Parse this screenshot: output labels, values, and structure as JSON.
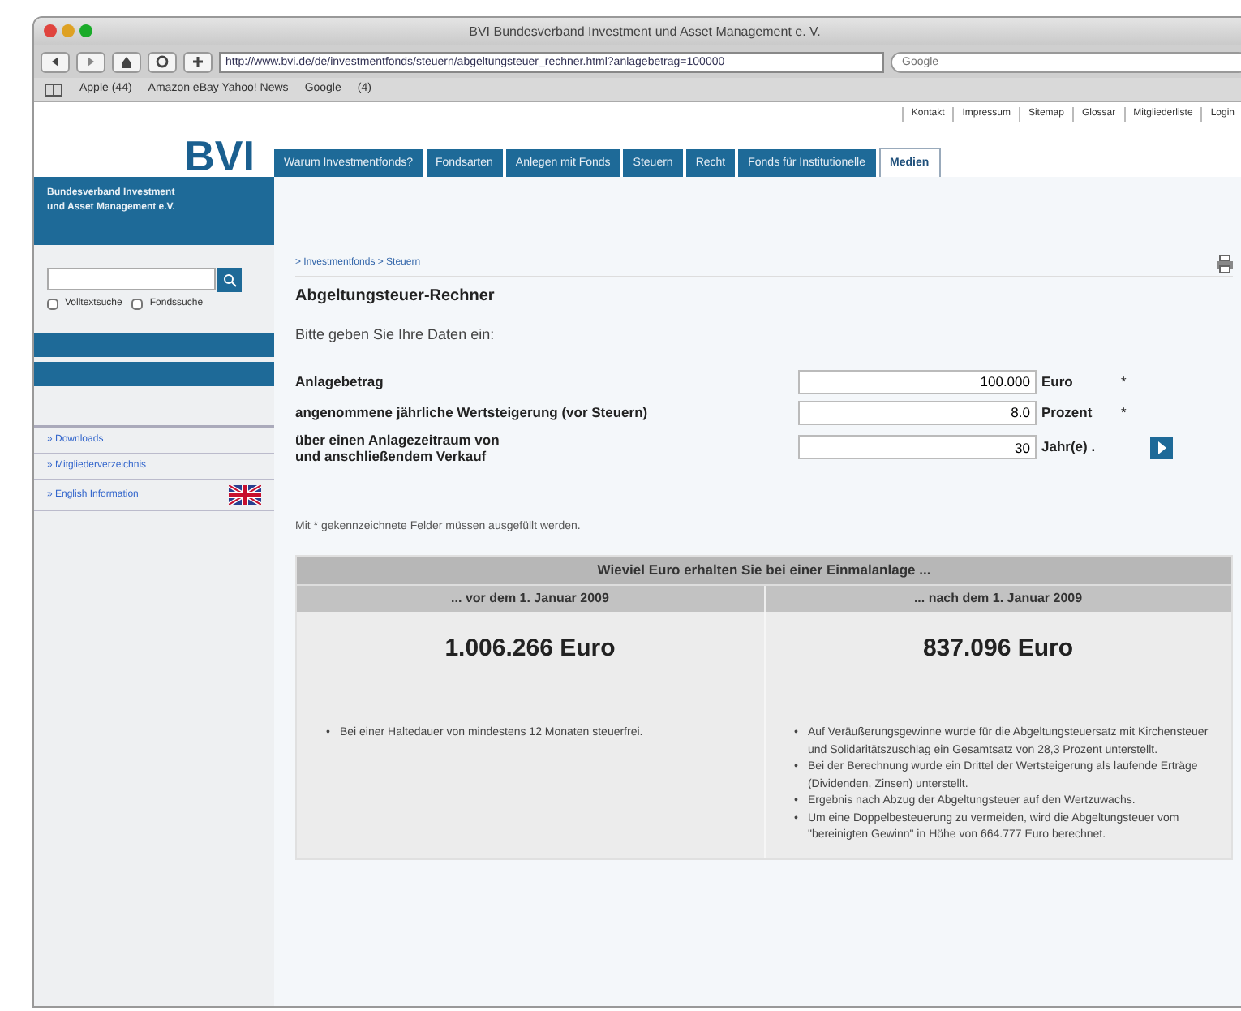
{
  "window": {
    "title": "BVI Bundesverband Investment und Asset Management e. V."
  },
  "toolbar": {
    "url": "http://www.bvi.de/de/investmentfonds/steuern/abgeltungsteuer_rechner.html?anlagebetrag=100000",
    "search_placeholder": "Google"
  },
  "bookmarks": [
    "Apple (44)",
    "Amazon eBay Yahoo! News",
    "Google",
    "(4)"
  ],
  "top_links": [
    "Kontakt",
    "Impressum",
    "Sitemap",
    "Glossar",
    "Mitgliederliste",
    "Login"
  ],
  "logo": {
    "text": "BVI",
    "subtitle": "Bundesverband Investment und Asset Management e.V."
  },
  "tabs": [
    {
      "label": "Warum Investmentfonds?",
      "selected": false
    },
    {
      "label": "Fondsarten",
      "selected": false
    },
    {
      "label": "Anlegen mit Fonds",
      "selected": false
    },
    {
      "label": "Steuern",
      "selected": false
    },
    {
      "label": "Recht",
      "selected": false
    },
    {
      "label": "Fonds für Institutionelle",
      "selected": false
    },
    {
      "label": "Medien",
      "selected": true
    }
  ],
  "sidebar": {
    "checkboxes": [
      {
        "label": "Volltextsuche",
        "checked": false
      },
      {
        "label": "Fondssuche",
        "checked": false
      }
    ],
    "links": [
      {
        "label": "» Downloads",
        "flag": false
      },
      {
        "label": "» Mitgliederverzeichnis",
        "flag": false
      },
      {
        "label": "» English Information",
        "flag": true
      }
    ]
  },
  "main": {
    "breadcrumb": "> Investmentfonds > Steuern",
    "heading": "Abgeltungsteuer-Rechner",
    "intro": "Bitte geben Sie Ihre Daten ein:",
    "fields": [
      {
        "label": "Anlagebetrag",
        "value": "100.000",
        "unit": "Euro",
        "mark": "*",
        "submit": false
      },
      {
        "label": "angenommene jährliche Wertsteigerung (vor Steuern)",
        "value": "8.0",
        "unit": "Prozent",
        "mark": "*",
        "submit": false
      },
      {
        "label": "über einen Anlagezeitraum von\nund anschließendem Verkauf",
        "value": "30",
        "unit": "Jahr(e) .",
        "submit": true
      }
    ],
    "note": "Mit * gekennzeichnete Felder müssen ausgefüllt werden.",
    "results": {
      "title": "Wieviel Euro erhalten Sie bei einer Einmalanlage ...",
      "columns": [
        {
          "heading": "... vor dem 1. Januar 2009",
          "amount": "1.006.266 Euro",
          "notes": [
            {
              "bullet": "•",
              "text": "Bei einer Haltedauer von mindestens 12 Monaten steuerfrei."
            }
          ]
        },
        {
          "heading": "... nach dem 1. Januar 2009",
          "amount": "837.096 Euro",
          "notes": [
            {
              "bullet": "•",
              "text": "Auf Veräußerungsgewinne wurde für die Abgeltungsteuersatz mit Kirchensteuer und Solidaritätszuschlag ein Gesamtsatz von 28,3 Prozent unterstellt."
            },
            {
              "bullet": "•",
              "text": "Bei der Berechnung wurde ein Drittel der Wertsteigerung als laufende Erträge (Dividenden, Zinsen) unterstellt."
            },
            {
              "bullet": "•",
              "text": "Ergebnis nach Abzug der Abgeltungsteuer auf den Wertzuwachs."
            },
            {
              "bullet": "•",
              "text": "Um eine Doppelbesteuerung zu vermeiden, wird die Abgeltungsteuer vom \"bereinigten Gewinn\" in Höhe von 664.777 Euro berechnet."
            }
          ]
        }
      ]
    }
  }
}
